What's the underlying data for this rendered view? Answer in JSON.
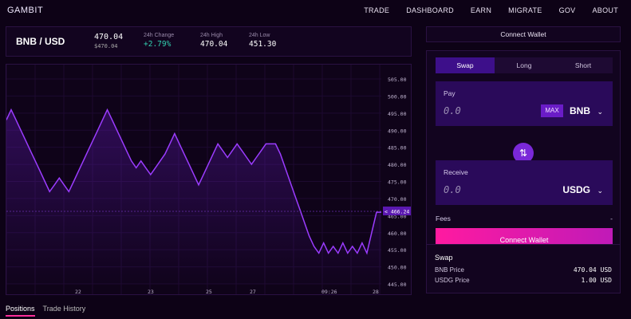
{
  "app": {
    "logo": "GAMBIT"
  },
  "nav": [
    "TRADE",
    "DASHBOARD",
    "EARN",
    "MIGRATE",
    "GOV",
    "ABOUT"
  ],
  "ticker": {
    "pair": "BNB / USD",
    "price": "470.04",
    "price_usd": "$470.04",
    "change_label": "24h Change",
    "change_value": "+2.79%",
    "high_label": "24h High",
    "high_value": "470.04",
    "low_label": "24h Low",
    "low_value": "451.30"
  },
  "chart_data": {
    "type": "line",
    "x_tick_labels": [
      "22",
      "23",
      "25",
      "27",
      "09:26",
      "28"
    ],
    "y_tick_labels": [
      "505.00",
      "500.00",
      "495.00",
      "490.00",
      "485.00",
      "480.00",
      "475.00",
      "470.00",
      "465.00",
      "460.00",
      "455.00",
      "450.00",
      "445.00"
    ],
    "ylim": [
      445,
      505
    ],
    "current_price_label": "466.24",
    "values": [
      493,
      496,
      493,
      490,
      487,
      484,
      481,
      478,
      475,
      472,
      474,
      476,
      474,
      472,
      475,
      478,
      481,
      484,
      487,
      490,
      493,
      496,
      493,
      490,
      487,
      484,
      481,
      479,
      481,
      479,
      477,
      479,
      481,
      483,
      486,
      489,
      486,
      483,
      480,
      477,
      474,
      477,
      480,
      483,
      486,
      484,
      482,
      484,
      486,
      484,
      482,
      480,
      482,
      484,
      486,
      486,
      486,
      483,
      479,
      475,
      471,
      467,
      463,
      459,
      456,
      454,
      457,
      454,
      456,
      454,
      457,
      454,
      456,
      454,
      457,
      454,
      460,
      466,
      466
    ],
    "series": [
      {
        "name": "BNB/USD",
        "color": "#9b3cff"
      }
    ]
  },
  "bottom_tabs": [
    "Positions",
    "Trade History"
  ],
  "wallet": {
    "connect_label": "Connect Wallet"
  },
  "swap": {
    "modes": [
      "Swap",
      "Long",
      "Short"
    ],
    "pay_label": "Pay",
    "pay_value": "0.0",
    "pay_token": "BNB",
    "max_label": "MAX",
    "receive_label": "Receive",
    "receive_value": "0.0",
    "receive_token": "USDG",
    "fees_label": "Fees",
    "fees_value": "-",
    "button_label": "Connect Wallet"
  },
  "info": {
    "title": "Swap",
    "rows": [
      {
        "label": "BNB Price",
        "value": "470.04 USD"
      },
      {
        "label": "USDG Price",
        "value": "1.00 USD"
      }
    ]
  },
  "colors": {
    "accent": "#ff1aa0",
    "line": "#9b3cff",
    "green": "#32d0b0"
  },
  "icons": [
    "swap-arrows-icon",
    "chevron-down-icon"
  ]
}
